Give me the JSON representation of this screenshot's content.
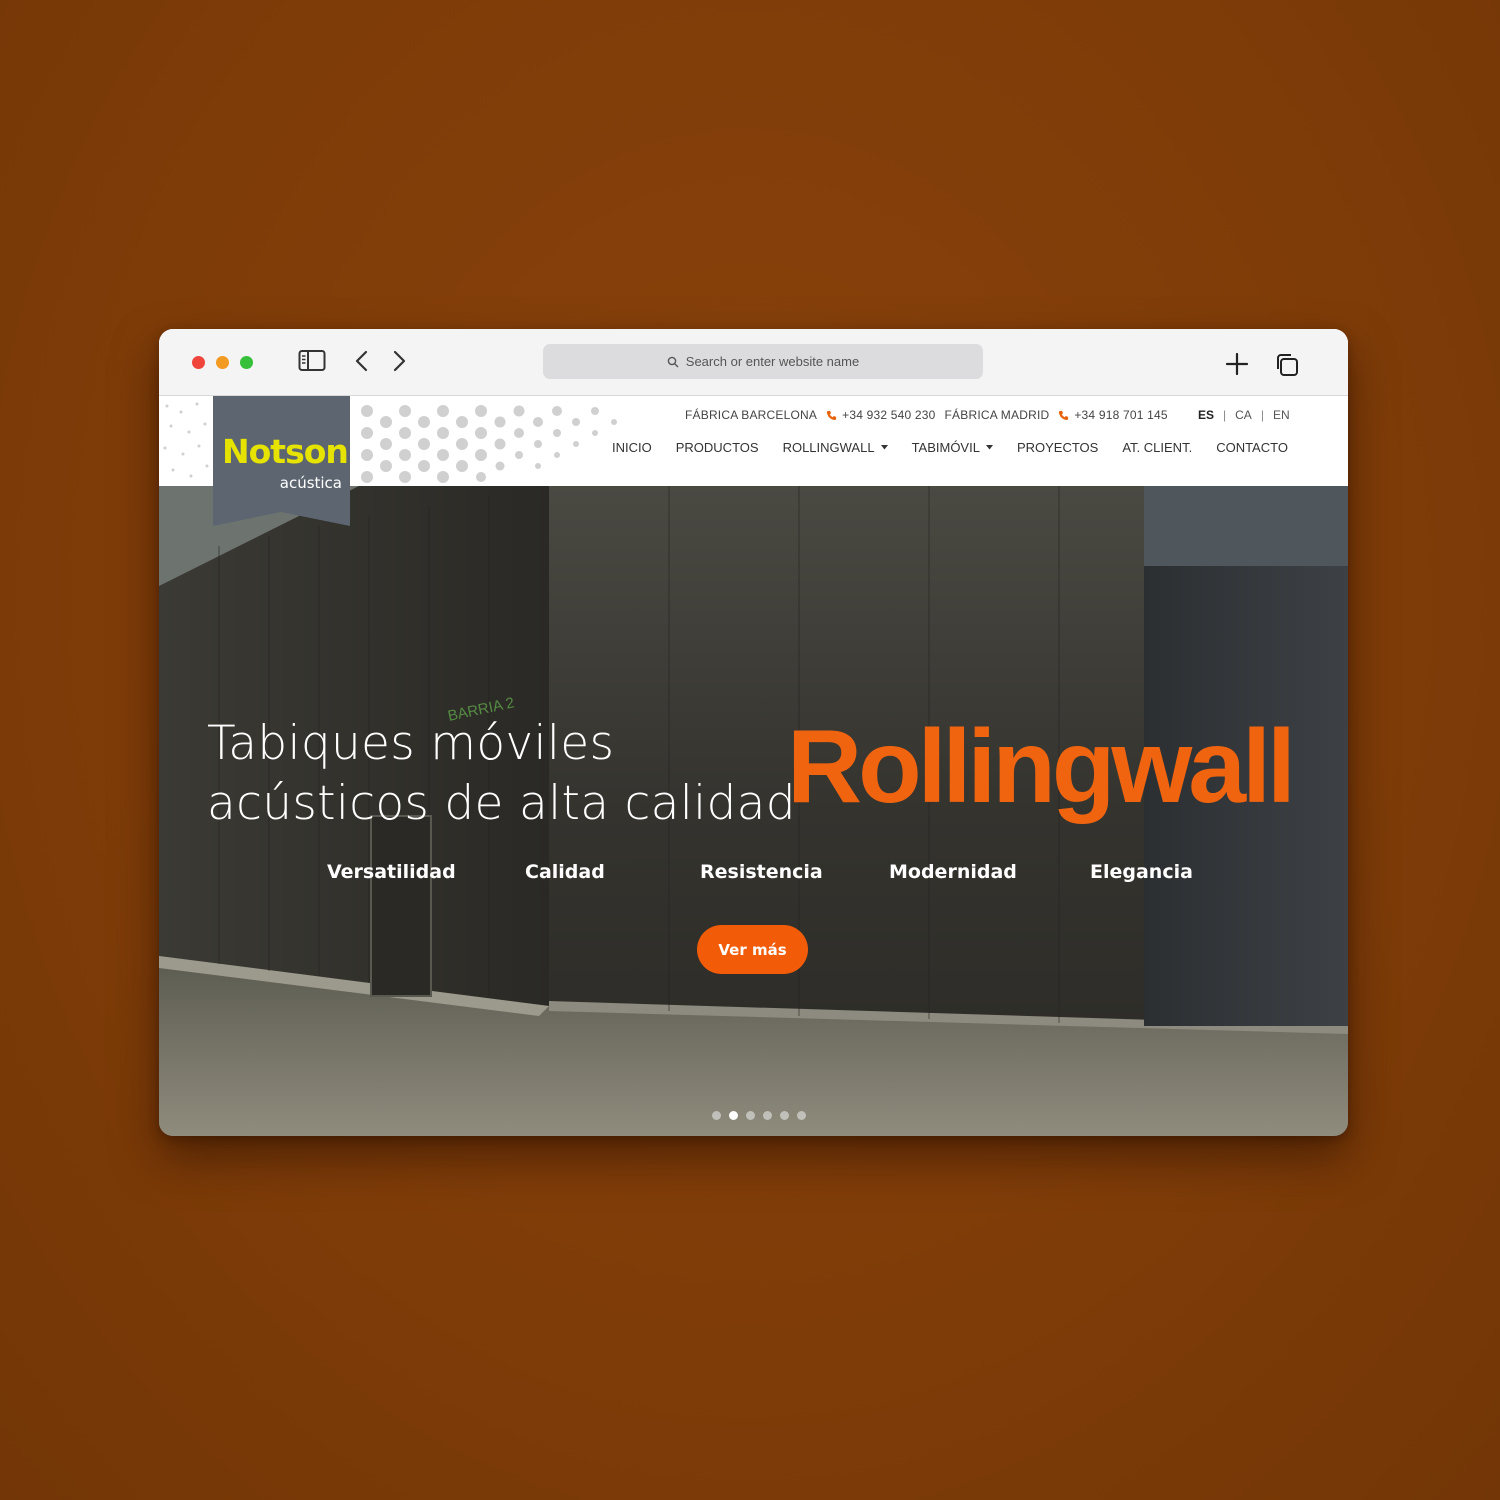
{
  "browser": {
    "address_placeholder": "Search or enter website name"
  },
  "logo": {
    "name": "Notson",
    "sub": "acústica"
  },
  "contact": {
    "barcelona_label": "FÁBRICA BARCELONA",
    "barcelona_phone": "+34 932 540 230",
    "madrid_label": "FÁBRICA MADRID",
    "madrid_phone": "+34 918 701 145"
  },
  "languages": [
    "ES",
    "CA",
    "EN"
  ],
  "active_language": "ES",
  "nav": {
    "items": [
      "INICIO",
      "PRODUCTOS",
      "ROLLINGWALL",
      "TABIMÓVIL",
      "PROYECTOS",
      "AT. CLIENT.",
      "CONTACTO"
    ]
  },
  "hero": {
    "line1": "Tabiques móviles",
    "line2": "acústicos de alta calidad",
    "brand": "Rollingwall",
    "features": [
      "Versatilidad",
      "Calidad",
      "Resistencia",
      "Modernidad",
      "Elegancia"
    ],
    "cta": "Ver más",
    "slides_total": 6,
    "active_slide": 2
  },
  "colors": {
    "accent": "#f06410",
    "logo_yellow": "#e6e300",
    "logo_bg": "#5d6670",
    "page_bg": "#7e3c08"
  }
}
